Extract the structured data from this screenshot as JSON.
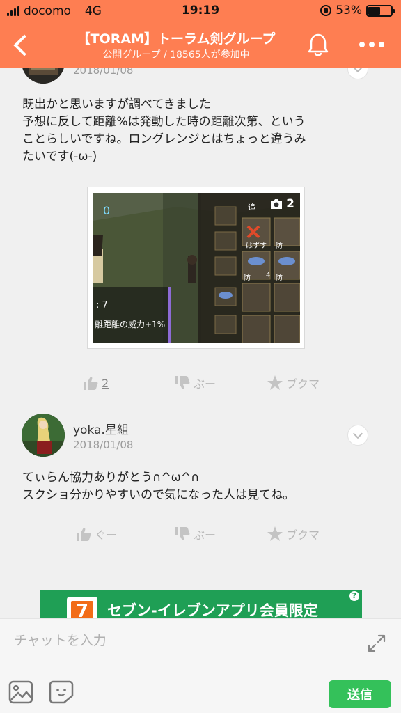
{
  "status_bar": {
    "carrier": "docomo",
    "network": "4G",
    "time": "19:19",
    "battery": "53%",
    "battery_level": 0.53
  },
  "header": {
    "title": "【TORAM】トーラム剣グループ",
    "subtitle": "公開グループ / 18565人が参加中"
  },
  "posts": [
    {
      "date": "2018/01/08",
      "text": "既出かと思いますが調べてきました\n予想に反して距離%は発動した時の距離次第、という\nことらしいですね。ロングレンジとはちょっと違うみ\nたいです(-ω-)",
      "photo": {
        "count": "2",
        "overlay_texts": [
          "0",
          "追",
          "はずす",
          "防",
          "防",
          "4",
          "防",
          ": 7",
          "離距離の威力+1%"
        ]
      },
      "actions": {
        "good": "2",
        "bad": "ぶー",
        "bookmark": "ブクマ"
      }
    },
    {
      "username": "yoka.星組",
      "date": "2018/01/08",
      "text": "てぃらん協力ありがとう∩^ω^∩\nスクショ分かりやすいので気になった人は見てね。",
      "actions": {
        "good": "ぐー",
        "bad": "ぶー",
        "bookmark": "ブクマ"
      }
    }
  ],
  "ad": {
    "text": "セブン-イレブンアプリ会員限定",
    "info": "?"
  },
  "chat": {
    "placeholder": "チャットを入力",
    "send_label": "送信"
  },
  "colors": {
    "header_bg": "#fe7e52",
    "send_button": "#34c15a",
    "ad_bg": "#1f9f55"
  }
}
